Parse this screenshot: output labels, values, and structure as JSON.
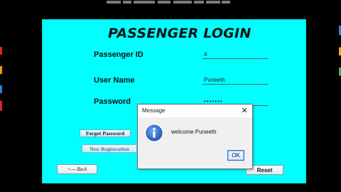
{
  "form": {
    "title": "PASSENGER LOGIN",
    "passenger_id_label": "Passenger  ID",
    "passenger_id_value": "4",
    "user_name_label": "User Name",
    "user_name_value": "Puneeth",
    "password_label": "Password",
    "password_value": "•••••••",
    "forgot_password_label": "Forgot Password",
    "new_registration_label": "New Registration",
    "back_label": "<--- Back",
    "reset_label": "Reset",
    "background_color": "#00ffff"
  },
  "dialog": {
    "title": "Message",
    "close_icon": "close-icon",
    "info_icon": "info-icon",
    "message": "welcome  Puneeth",
    "ok_label": "OK"
  }
}
